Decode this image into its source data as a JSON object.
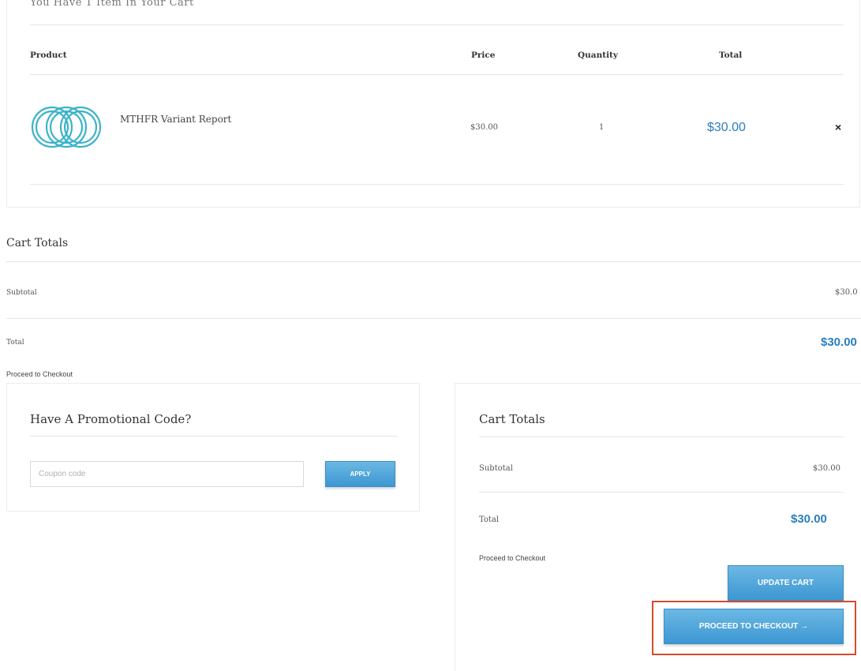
{
  "cart": {
    "heading": "You Have 1 Item In Your Cart",
    "columns": {
      "product": "Product",
      "price": "Price",
      "quantity": "Quantity",
      "total": "Total"
    },
    "items": [
      {
        "name": "MTHFR Variant Report",
        "price": "$30.00",
        "quantity": "1",
        "total": "$30.00",
        "remove_label": "×"
      }
    ]
  },
  "cart_totals_full": {
    "title": "Cart Totals",
    "subtotal_label": "Subtotal",
    "subtotal_value": "$30.0",
    "total_label": "Total",
    "total_value": "$30.00",
    "proceed_label": "Proceed to Checkout"
  },
  "promo": {
    "title": "Have A Promotional Code?",
    "coupon_placeholder": "Coupon code",
    "apply_label": "APPLY"
  },
  "cart_totals_box": {
    "title": "Cart Totals",
    "subtotal_label": "Subtotal",
    "subtotal_value": "$30.00",
    "total_label": "Total",
    "total_value": "$30.00",
    "proceed_label": "Proceed to Checkout",
    "update_cart_label": "UPDATE CART",
    "checkout_button_label": "PROCEED TO CHECKOUT →"
  },
  "colors": {
    "accent_blue": "#2a7fbf",
    "button_blue": "#4aa3db",
    "highlight_red": "#d64a2a",
    "logo_teal": "#3bb3c9"
  },
  "icons": {
    "product_logo": "interlocking-rings-logo",
    "remove": "close-icon",
    "arrow": "arrow-right-icon"
  }
}
